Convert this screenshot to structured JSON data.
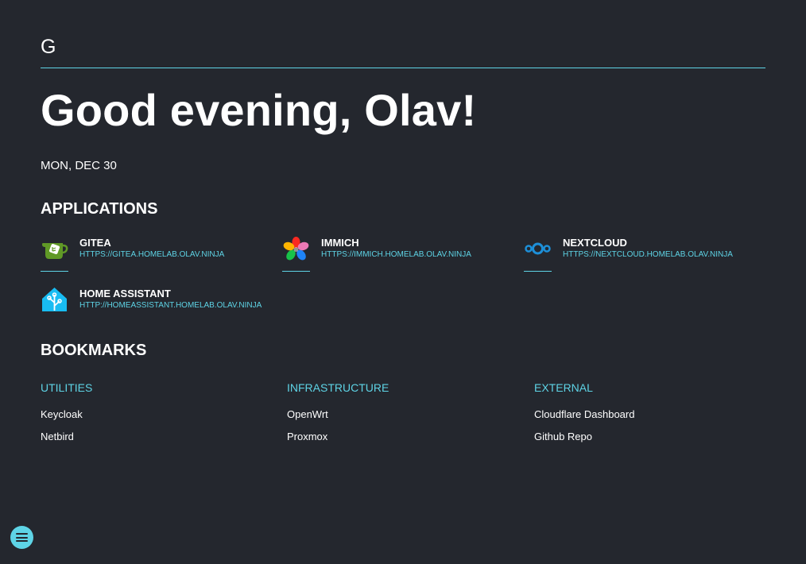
{
  "header": {
    "logo_letter": "G"
  },
  "greeting": "Good evening, Olav!",
  "date": "MON, DEC 30",
  "applications": {
    "title": "APPLICATIONS",
    "items": [
      {
        "name": "GITEA",
        "url": "HTTPS://GITEA.HOMELAB.OLAV.NINJA",
        "icon": "gitea-icon"
      },
      {
        "name": "IMMICH",
        "url": "HTTPS://IMMICH.HOMELAB.OLAV.NINJA",
        "icon": "immich-icon"
      },
      {
        "name": "NEXTCLOUD",
        "url": "HTTPS://NEXTCLOUD.HOMELAB.OLAV.NINJA",
        "icon": "nextcloud-icon"
      },
      {
        "name": "HOME ASSISTANT",
        "url": "HTTP://HOMEASSISTANT.HOMELAB.OLAV.NINJA",
        "icon": "home-assistant-icon"
      }
    ]
  },
  "bookmarks": {
    "title": "BOOKMARKS",
    "groups": [
      {
        "category": "UTILITIES",
        "links": [
          "Keycloak",
          "Netbird"
        ]
      },
      {
        "category": "INFRASTRUCTURE",
        "links": [
          "OpenWrt",
          "Proxmox"
        ]
      },
      {
        "category": "EXTERNAL",
        "links": [
          "Cloudflare Dashboard",
          "Github Repo"
        ]
      }
    ]
  },
  "colors": {
    "background": "#24272e",
    "accent": "#5ed4e6",
    "text": "#ffffff"
  },
  "menu_button": {
    "icon": "hamburger-menu-icon"
  }
}
